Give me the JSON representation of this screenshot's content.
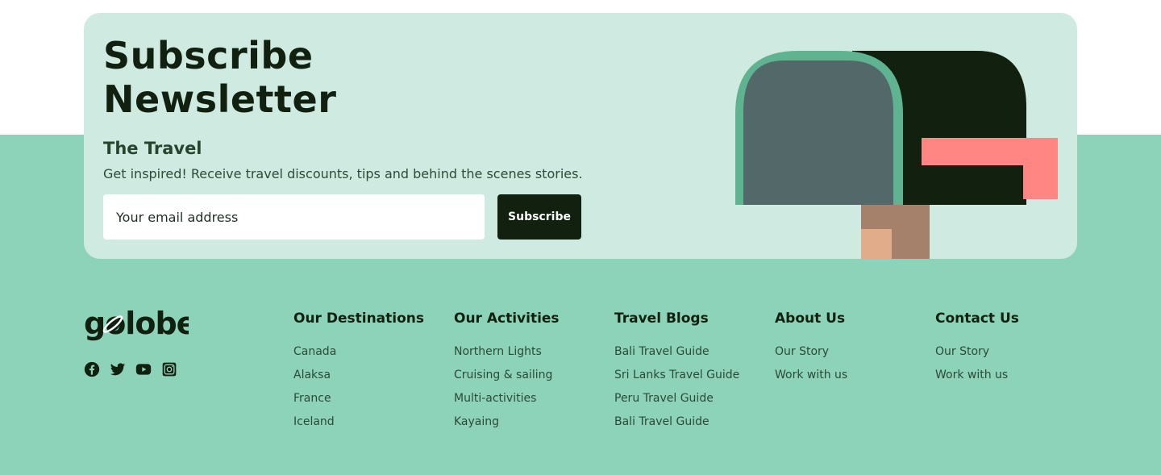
{
  "newsletter": {
    "title_line1": "Subscribe",
    "title_line2": "Newsletter",
    "subtitle": "The Travel",
    "description": "Get inspired! Receive travel discounts, tips and behind the scenes stories.",
    "email_placeholder": "Your email address",
    "subscribe_label": "Subscribe"
  },
  "brand": {
    "name": "golobe",
    "social_icons": [
      "facebook-icon",
      "twitter-icon",
      "youtube-icon",
      "instagram-icon"
    ]
  },
  "columns": [
    {
      "title": "Our Destinations",
      "links": [
        "Canada",
        "Alaksa",
        "France",
        "Iceland"
      ]
    },
    {
      "title": "Our Activities",
      "links": [
        "Northern Lights",
        "Cruising & sailing",
        "Multi-activities",
        "Kayaing"
      ]
    },
    {
      "title": "Travel Blogs",
      "links": [
        "Bali Travel Guide",
        "Sri Lanks Travel Guide",
        "Peru Travel Guide",
        "Bali Travel Guide"
      ]
    },
    {
      "title": "About Us",
      "links": [
        "Our Story",
        "Work with us"
      ]
    },
    {
      "title": "Contact Us",
      "links": [
        "Our Story",
        "Work with us"
      ]
    }
  ],
  "colors": {
    "footer_bg": "#8dd3ba",
    "card_bg": "#cfeae0",
    "dark": "#11200f",
    "mailbox_door": "#536868",
    "mailbox_rim": "#5fb391",
    "flag": "#ff8682",
    "post": "#a5806b",
    "post_light": "#e0ac8a"
  }
}
